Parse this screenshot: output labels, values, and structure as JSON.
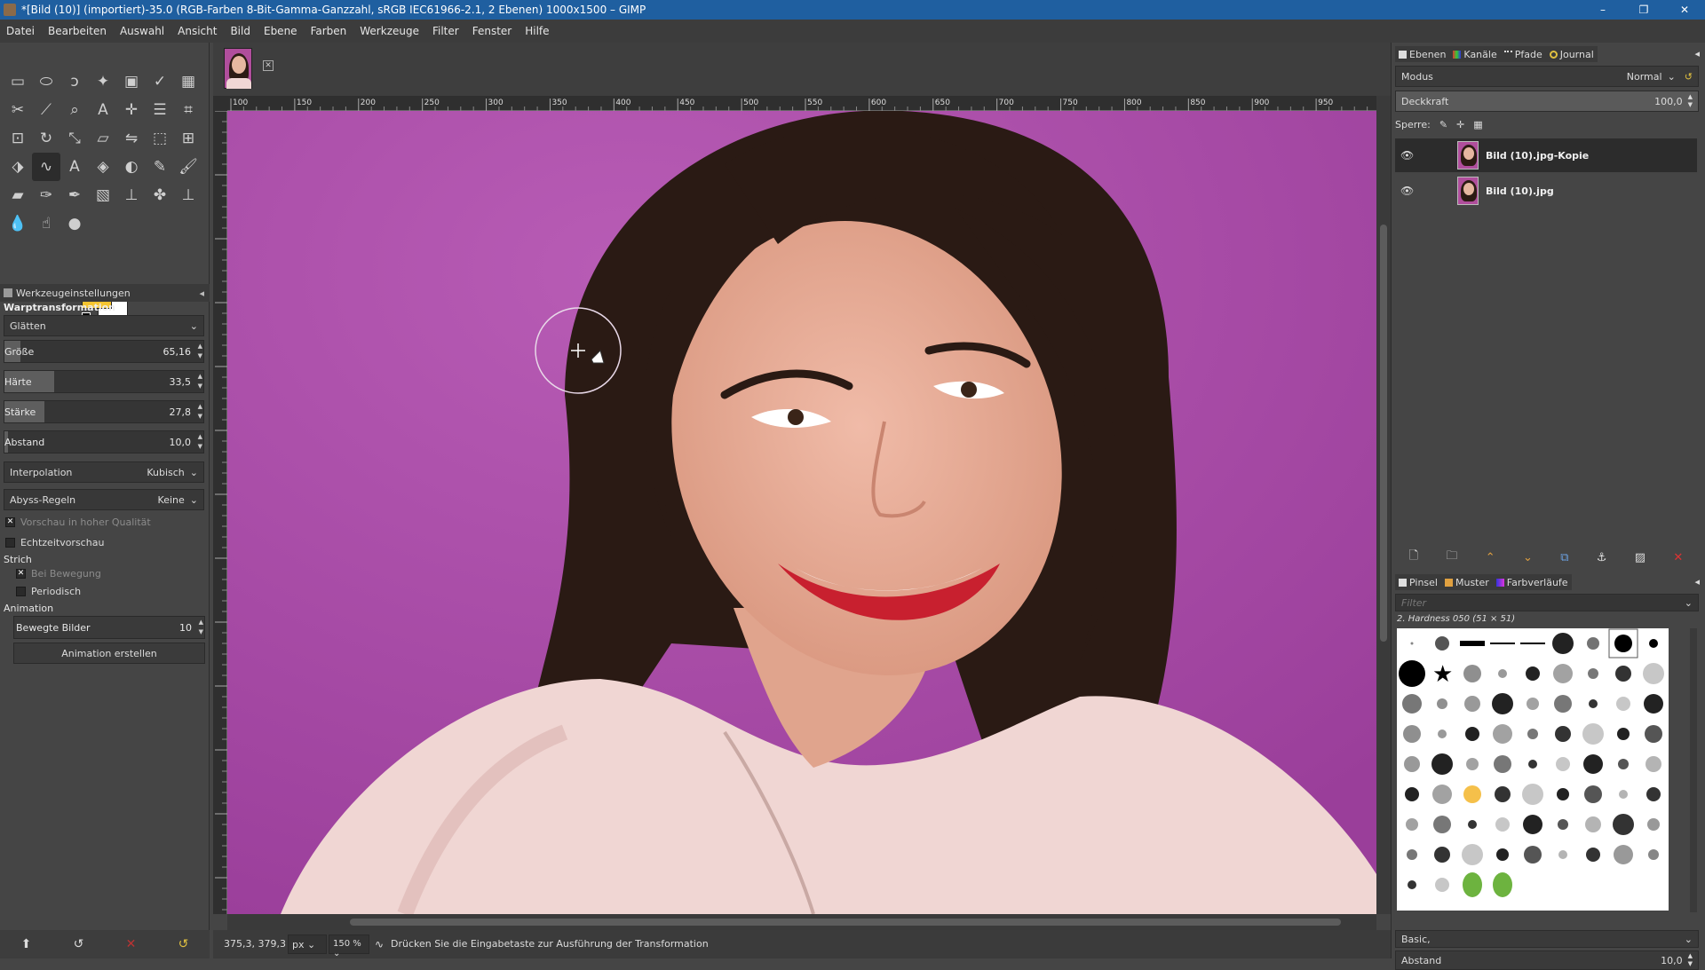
{
  "window": {
    "title": "*[Bild (10)] (importiert)-35.0 (RGB-Farben 8-Bit-Gamma-Ganzzahl, sRGB IEC61966-2.1, 2 Ebenen) 1000x1500 – GIMP",
    "minimize": "–",
    "maximize": "❐",
    "close": "✕"
  },
  "menu": [
    "Datei",
    "Bearbeiten",
    "Auswahl",
    "Ansicht",
    "Bild",
    "Ebene",
    "Farben",
    "Werkzeuge",
    "Filter",
    "Fenster",
    "Hilfe"
  ],
  "tool_options": {
    "header": "Werkzeugeinstellungen",
    "tool_name": "Warptransformation",
    "behavior": "Glätten",
    "sliders": [
      {
        "name": "Größe",
        "value": "65,16",
        "fill": 0.08
      },
      {
        "name": "Härte",
        "value": "33,5",
        "fill": 0.25
      },
      {
        "name": "Stärke",
        "value": "27,8",
        "fill": 0.2
      },
      {
        "name": "Abstand",
        "value": "10,0",
        "fill": 0.02
      }
    ],
    "interpolation_label": "Interpolation",
    "interpolation_value": "Kubisch",
    "abyss_label": "Abyss-Regeln",
    "abyss_value": "Keine",
    "hq_preview": "Vorschau in hoher Qualität",
    "realtime_preview": "Echtzeitvorschau",
    "stroke_section": "Strich",
    "during_motion": "Bei Bewegung",
    "periodic": "Periodisch",
    "animation_section": "Animation",
    "frames_label": "Bewegte Bilder",
    "frames_value": "10",
    "create_animation": "Animation erstellen"
  },
  "colors": {
    "foreground": "#f5c530",
    "background": "#ffffff",
    "canvas_bg": "#a84aa6"
  },
  "status": {
    "coords": "375,3, 379,3",
    "unit": "px",
    "zoom": "150 %",
    "message": "Drücken Sie die Eingabetaste zur Ausführung der Transformation"
  },
  "ruler_labels": [
    "100",
    "150",
    "200",
    "250",
    "300",
    "350",
    "400",
    "450",
    "500",
    "550",
    "600",
    "650",
    "700",
    "750",
    "800",
    "850",
    "900",
    "950"
  ],
  "layers_panel": {
    "tabs": [
      "Ebenen",
      "Kanäle",
      "Pfade",
      "Journal"
    ],
    "mode_label": "Modus",
    "mode_value": "Normal",
    "opacity_label": "Deckkraft",
    "opacity_value": "100,0",
    "lock_label": "Sperre:",
    "layers": [
      {
        "name": "Bild (10).jpg-Kopie",
        "selected": true
      },
      {
        "name": "Bild (10).jpg",
        "selected": false
      }
    ]
  },
  "brushes_panel": {
    "tabs": [
      "Pinsel",
      "Muster",
      "Farbverläufe"
    ],
    "filter_placeholder": "Filter",
    "current_brush": "2. Hardness 050 (51 × 51)",
    "preset": "Basic,",
    "spacing_label": "Abstand",
    "spacing_value": "10,0"
  }
}
